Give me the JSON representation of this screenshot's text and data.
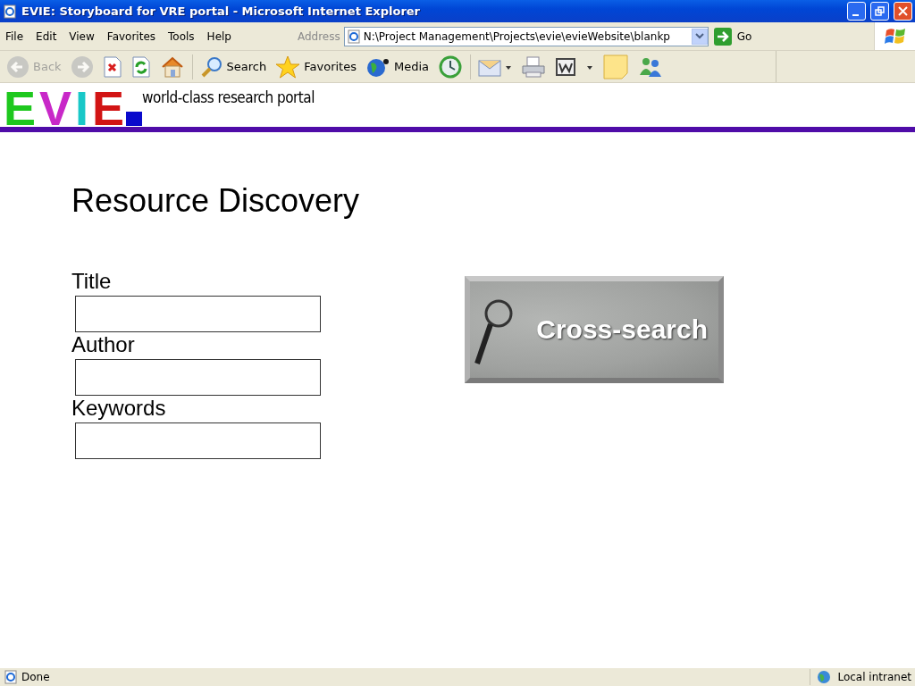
{
  "window": {
    "title": "EVIE: Storyboard for VRE portal - Microsoft Internet Explorer"
  },
  "menu": [
    "File",
    "Edit",
    "View",
    "Favorites",
    "Tools",
    "Help"
  ],
  "address": {
    "label": "Address",
    "value": "N:\\Project Management\\Projects\\evie\\evieWebsite\\blankp",
    "go": "Go"
  },
  "toolbar": [
    {
      "kind": "back",
      "label": "Back",
      "disabled": true
    },
    {
      "kind": "forward",
      "disabled": true
    },
    {
      "kind": "stop",
      "disabled": false
    },
    {
      "kind": "refresh",
      "disabled": false
    },
    {
      "kind": "home",
      "disabled": false
    },
    {
      "kind": "search",
      "label": "Search",
      "disabled": false
    },
    {
      "kind": "favorites",
      "label": "Favorites",
      "disabled": false
    },
    {
      "kind": "media",
      "label": "Media",
      "disabled": false
    },
    {
      "kind": "history",
      "disabled": false
    },
    {
      "kind": "mail",
      "disabled": false
    },
    {
      "kind": "print",
      "disabled": false
    },
    {
      "kind": "edit",
      "disabled": false
    },
    {
      "kind": "note",
      "disabled": false
    },
    {
      "kind": "messenger",
      "disabled": false
    }
  ],
  "page": {
    "logo": [
      {
        "letter": "E",
        "color": "#1ec81e"
      },
      {
        "letter": "V",
        "color": "#c828c8"
      },
      {
        "letter": "I",
        "color": "#19c8c8"
      },
      {
        "letter": "E",
        "color": "#d21414"
      }
    ],
    "tagline": "world-class research portal",
    "heading": "Resource Discovery",
    "fields": [
      {
        "label": "Title"
      },
      {
        "label": "Author"
      },
      {
        "label": "Keywords"
      }
    ],
    "cross_search": "Cross-search"
  },
  "status_bar": {
    "text": "Done",
    "zone": "Local intranet"
  }
}
